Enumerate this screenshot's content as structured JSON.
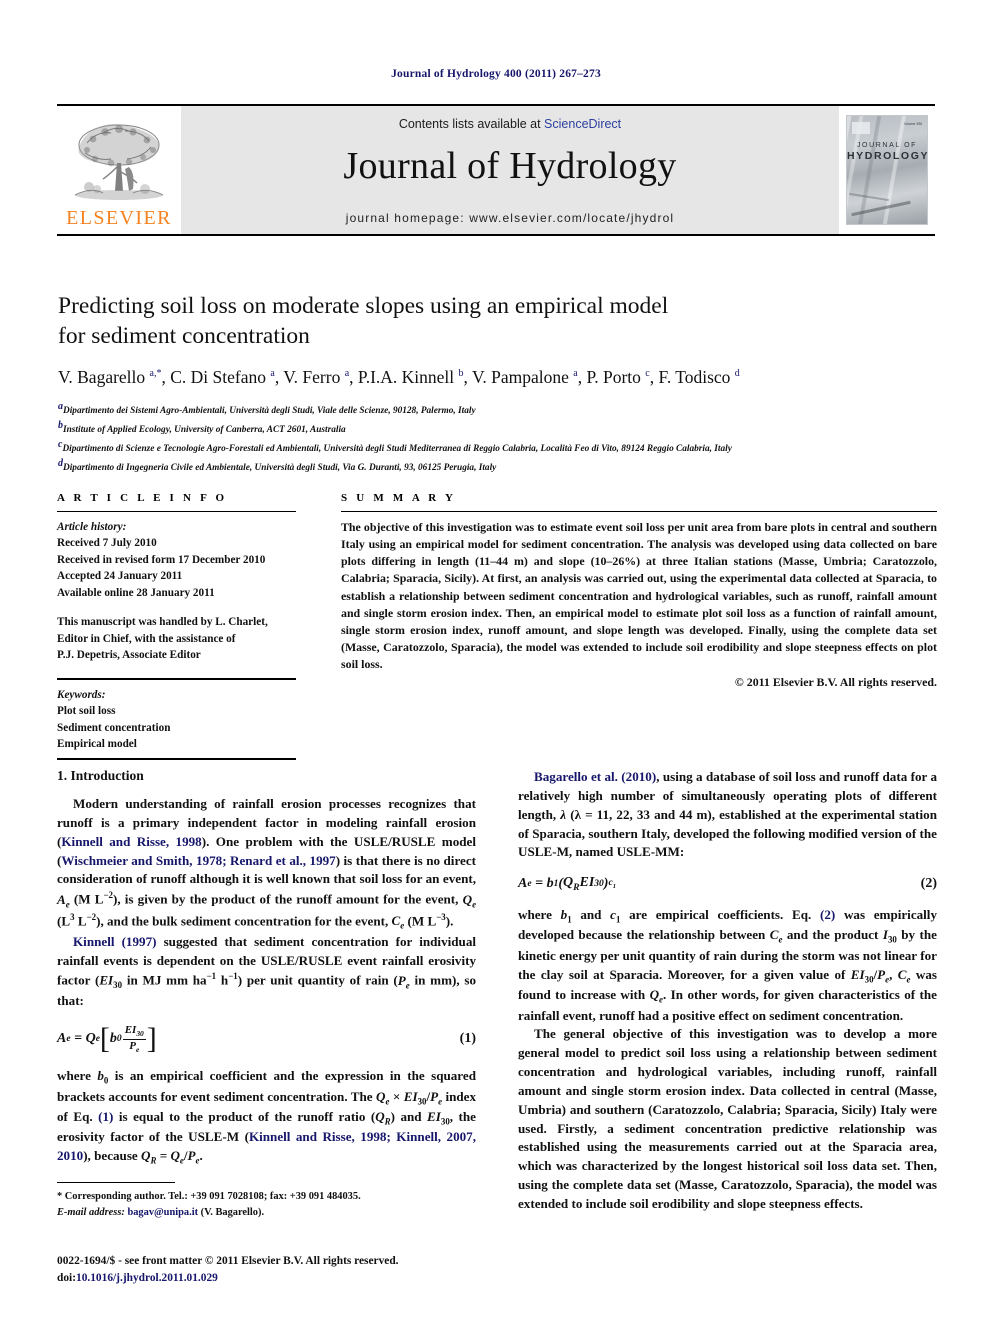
{
  "running_head": "Journal of Hydrology 400 (2011) 267–273",
  "masthead": {
    "contents_prefix": "Contents lists available at ",
    "contents_link": "ScienceDirect",
    "journal_name": "Journal of Hydrology",
    "homepage": "journal homepage: www.elsevier.com/locate/jhydrol",
    "publisher_logo_word": "ELSEVIER",
    "cover": {
      "line1": "JOURNAL OF",
      "line2": "HYDROLOGY",
      "corner_tag": "Volume 396"
    }
  },
  "article": {
    "title_line1": "Predicting soil loss on moderate slopes using an empirical model",
    "title_line2": "for sediment concentration",
    "authors_html": "V. Bagarello <sup>a,*</sup>, C. Di Stefano <sup>a</sup>, V. Ferro <sup>a</sup>, P.I.A. Kinnell <sup>b</sup>, V. Pampalone <sup>a</sup>, P. Porto <sup>c</sup>, F. Todisco <sup>d</sup>",
    "affiliations": [
      "a Dipartimento dei Sistemi Agro-Ambientali, Università degli Studi, Viale delle Scienze, 90128, Palermo, Italy",
      "b Institute of Applied Ecology, University of Canberra, ACT 2601, Australia",
      "c Dipartimento di Scienze e Tecnologie Agro-Forestali ed Ambientali, Università degli Studi Mediterranea di Reggio Calabria, Località Feo di Vito, 89124 Reggio Calabria, Italy",
      "d Dipartimento di Ingegneria Civile ed Ambientale, Università degli Studi, Via G. Duranti, 93, 06125 Perugia, Italy"
    ]
  },
  "article_info": {
    "heading": "A R T I C L E    I N F O",
    "history_label": "Article history:",
    "history": [
      "Received 7 July 2010",
      "Received in revised form 17 December 2010",
      "Accepted 24 January 2011",
      "Available online 28 January 2011"
    ],
    "handling": [
      "This manuscript was handled by L. Charlet,",
      "Editor in Chief, with the assistance of",
      "P.J. Depetris, Associate Editor"
    ],
    "keywords_label": "Keywords:",
    "keywords": [
      "Plot soil loss",
      "Sediment concentration",
      "Empirical model"
    ]
  },
  "summary": {
    "heading": "S U M M A R Y",
    "text": "The objective of this investigation was to estimate event soil loss per unit area from bare plots in central and southern Italy using an empirical model for sediment concentration. The analysis was developed using data collected on bare plots differing in length (11–44 m) and slope (10–26%) at three Italian stations (Masse, Umbria; Caratozzolo, Calabria; Sparacia, Sicily). At first, an analysis was carried out, using the experimental data collected at Sparacia, to establish a relationship between sediment concentration and hydrological variables, such as runoff, rainfall amount and single storm erosion index. Then, an empirical model to estimate plot soil loss as a function of rainfall amount, single storm erosion index, runoff amount, and slope length was developed. Finally, using the complete data set (Masse, Caratozzolo, Sparacia), the model was extended to include soil erodibility and slope steepness effects on plot soil loss.",
    "copyright": "© 2011 Elsevier B.V. All rights reserved."
  },
  "body": {
    "section1_heading": "1. Introduction",
    "left_p1_html": "Modern understanding of rainfall erosion processes recognizes that runoff is a primary independent factor in modeling rainfall erosion (<span class=\"ref\">Kinnell and Risse, 1998</span>). One problem with the USLE/RUSLE model (<span class=\"ref\">Wischmeier and Smith, 1978; Renard et al., 1997</span>) is that there is no direct consideration of runoff although it is well known that soil loss for an event, <i>A<sub>e</sub></i> (M L<sup>−2</sup>), is given by the product of the runoff amount for the event, <i>Q<sub>e</sub></i> (L<sup>3</sup> L<sup>−2</sup>), and the bulk sediment concentration for the event, <i>C<sub>e</sub></i> (M L<sup>−3</sup>).",
    "left_p2_html": "<span class=\"ref\">Kinnell (1997)</span> suggested that sediment concentration for individual rainfall events is dependent on the USLE/RUSLE event rainfall erosivity factor (<i>EI</i><sub>30</sub> in MJ mm ha<sup>−1</sup> h<sup>−1</sup>) per unit quantity of rain (<i>P<sub>e</sub></i> in mm), so that:",
    "eq1_number": "(1)",
    "left_p3_html": "where <i>b</i><sub>0</sub> is an empirical coefficient and the expression in the squared brackets accounts for event sediment concentration. The <i>Q<sub>e</sub></i> × <i>EI</i><sub>30</sub>/<i>P<sub>e</sub></i> index of Eq. <span class=\"ref\">(1)</span> is equal to the product of the runoff ratio (<i>Q<sub>R</sub></i>) and <i>EI</i><sub>30</sub>, the erosivity factor of the USLE-M (<span class=\"ref\">Kinnell and Risse, 1998; Kinnell, 2007, 2010</span>), because <i>Q<sub>R</sub></i> = <i>Q<sub>e</sub></i>/<i>P<sub>e</sub></i>.",
    "right_p1_html": "<span class=\"ref\">Bagarello et al. (2010)</span>, using a database of soil loss and runoff data for a relatively high number of simultaneously operating plots of different length, <i>λ</i> (λ = 11, 22, 33 and 44 m), established at the experimental station of Sparacia, southern Italy, developed the following modified version of the USLE-M, named USLE-MM:",
    "eq2_number": "(2)",
    "right_p2_html": "where <i>b</i><sub>1</sub> and <i>c</i><sub>1</sub> are empirical coefficients. Eq. <span class=\"ref\">(2)</span> was empirically developed because the relationship between <i>C<sub>e</sub></i> and the product <i>I</i><sub>30</sub> by the kinetic energy per unit quantity of rain during the storm was not linear for the clay soil at Sparacia. Moreover, for a given value of <i>EI</i><sub>30</sub>/<i>P<sub>e</sub></i>, <i>C<sub>e</sub></i> was found to increase with <i>Q<sub>e</sub></i>. In other words, for given characteristics of the rainfall event, runoff had a positive effect on sediment concentration.",
    "right_p3_html": "The general objective of this investigation was to develop a more general model to predict soil loss using a relationship between sediment concentration and hydrological variables, including runoff, rainfall amount and single storm erosion index. Data collected in central (Masse, Umbria) and southern (Caratozzolo, Calabria; Sparacia, Sicily) Italy were used. Firstly, a sediment concentration predictive relationship was established using the measurements carried out at the Sparacia area, which was characterized by the longest historical soil loss data set. Then, using the complete data set (Masse, Caratozzolo, Sparacia), the model was extended to include soil erodibility and slope steepness effects."
  },
  "footnote": {
    "corresponding": "* Corresponding author. Tel.: +39 091 7028108; fax: +39 091 484035.",
    "email_label": "E-mail address:",
    "email": "bagav@unipa.it",
    "email_suffix": "(V. Bagarello)."
  },
  "imprint": {
    "line1": "0022-1694/$ - see front matter © 2011 Elsevier B.V. All rights reserved.",
    "doi_label": "doi:",
    "doi": "10.1016/j.jhydrol.2011.01.029"
  },
  "colors": {
    "link": "#16166b",
    "sciencedirect": "#2b3f9e",
    "elsevier_orange": "#f5821f",
    "masthead_bg": "#e6e6e6"
  }
}
